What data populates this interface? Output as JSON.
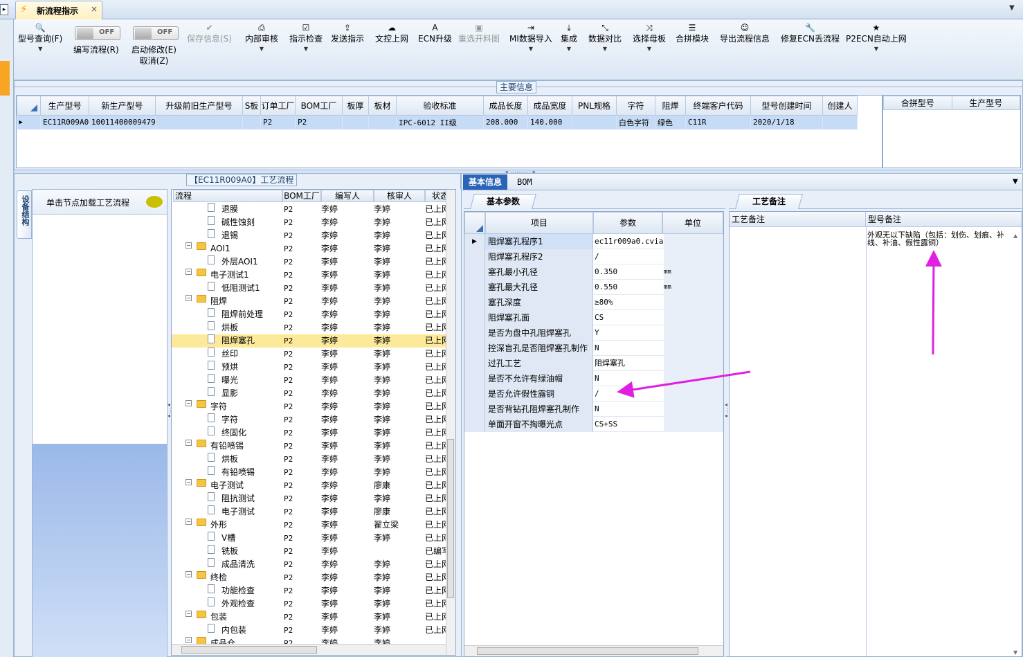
{
  "tab": {
    "title": "新流程指示",
    "close": "×"
  },
  "toolbar": [
    {
      "label": "型号查询(F)",
      "icon": "search-icon",
      "glyph": "🔍",
      "disabled": false,
      "dropdown": true
    },
    {
      "label": "编写流程(R)",
      "toggle": "OFF"
    },
    {
      "label": "启动修改(E)",
      "label2": "取消(Z)",
      "toggle": "OFF"
    },
    {
      "label": "保存信息(S)",
      "icon": "check-icon",
      "glyph": "✔",
      "disabled": true,
      "dropdown": false
    },
    {
      "label": "内部审核",
      "icon": "printer-icon",
      "glyph": "⎙",
      "disabled": false,
      "dropdown": true
    },
    {
      "label": "指示检查",
      "icon": "checkbox-icon",
      "glyph": "☑",
      "disabled": false,
      "dropdown": true
    },
    {
      "label": "发送指示",
      "icon": "upload-icon",
      "glyph": "⇪",
      "disabled": false,
      "dropdown": false
    },
    {
      "label": "文控上网",
      "icon": "cloud-icon",
      "glyph": "☁",
      "disabled": false,
      "dropdown": false
    },
    {
      "label": "ECN升级",
      "icon": "font-icon",
      "glyph": "A",
      "disabled": false,
      "dropdown": false
    },
    {
      "label": "重选开料图",
      "icon": "image-icon",
      "glyph": "▣",
      "disabled": true,
      "dropdown": false
    },
    {
      "label": "MI数据导入",
      "icon": "import-icon",
      "glyph": "⇥",
      "disabled": false,
      "dropdown": true
    },
    {
      "label": "集成",
      "icon": "download-icon",
      "glyph": "⤓",
      "disabled": false,
      "dropdown": true
    },
    {
      "label": "数据对比",
      "icon": "compress-icon",
      "glyph": "⤡",
      "disabled": false,
      "dropdown": true
    },
    {
      "label": "选择母板",
      "icon": "shuffle-icon",
      "glyph": "⤨",
      "disabled": false,
      "dropdown": true
    },
    {
      "label": "合拼模块",
      "icon": "list-icon",
      "glyph": "☰",
      "disabled": false,
      "dropdown": false
    },
    {
      "label": "导出流程信息",
      "icon": "smiley-icon",
      "glyph": "☺",
      "disabled": false,
      "dropdown": false
    },
    {
      "label": "修复ECN丢流程",
      "icon": "wrench-icon",
      "glyph": "🔧",
      "disabled": false,
      "dropdown": false
    },
    {
      "label": "P2ECN自动上网",
      "icon": "star-icon",
      "glyph": "★",
      "disabled": false,
      "dropdown": true
    }
  ],
  "main": {
    "title": "主要信息",
    "columns": [
      "生产型号",
      "新生产型号",
      "升级前旧生产型号",
      "S板",
      "订单工厂",
      "BOM工厂",
      "板厚",
      "板材",
      "验收标准",
      "成品长度",
      "成品宽度",
      "PNL规格",
      "字符",
      "阻焊",
      "终端客户代码",
      "型号创建时间",
      "创建人"
    ],
    "row": [
      "EC11R009A0",
      "10011400009479",
      "",
      "",
      "P2",
      "P2",
      "",
      "",
      "IPC-6012 II级",
      "208.000",
      "140.000",
      "",
      "白色字符",
      "绿色",
      "C11R",
      "2020/1/18",
      ""
    ],
    "merge_columns": [
      "合拼型号",
      "生产型号"
    ]
  },
  "flow": {
    "title": "【EC11R009A0】工艺流程",
    "side_tab": "设备结构",
    "hint": "单击节点加载工艺流程",
    "columns": [
      "流程",
      "BOM工厂",
      "编写人",
      "核审人",
      "状态"
    ],
    "rows": [
      {
        "name": "退膜",
        "level": 2,
        "bom": "P2",
        "writer": "李婷",
        "reviewer": "李婷",
        "status": "已上网"
      },
      {
        "name": "碱性蚀刻",
        "level": 2,
        "bom": "P2",
        "writer": "李婷",
        "reviewer": "李婷",
        "status": "已上网"
      },
      {
        "name": "退锡",
        "level": 2,
        "bom": "P2",
        "writer": "李婷",
        "reviewer": "李婷",
        "status": "已上网"
      },
      {
        "name": "AOI1",
        "level": 1,
        "bom": "P2",
        "writer": "李婷",
        "reviewer": "李婷",
        "status": "已上网"
      },
      {
        "name": "外层AOI1",
        "level": 2,
        "bom": "P2",
        "writer": "李婷",
        "reviewer": "李婷",
        "status": "已上网"
      },
      {
        "name": "电子测试1",
        "level": 1,
        "bom": "P2",
        "writer": "李婷",
        "reviewer": "李婷",
        "status": "已上网"
      },
      {
        "name": "低阻测试1",
        "level": 2,
        "bom": "P2",
        "writer": "李婷",
        "reviewer": "李婷",
        "status": "已上网"
      },
      {
        "name": "阻焊",
        "level": 1,
        "bom": "P2",
        "writer": "李婷",
        "reviewer": "李婷",
        "status": "已上网"
      },
      {
        "name": "阻焊前处理",
        "level": 2,
        "bom": "P2",
        "writer": "李婷",
        "reviewer": "李婷",
        "status": "已上网"
      },
      {
        "name": "烘板",
        "level": 2,
        "bom": "P2",
        "writer": "李婷",
        "reviewer": "李婷",
        "status": "已上网"
      },
      {
        "name": "阻焊塞孔",
        "level": 2,
        "bom": "P2",
        "writer": "李婷",
        "reviewer": "李婷",
        "status": "已上网",
        "selected": true
      },
      {
        "name": "丝印",
        "level": 2,
        "bom": "P2",
        "writer": "李婷",
        "reviewer": "李婷",
        "status": "已上网"
      },
      {
        "name": "预烘",
        "level": 2,
        "bom": "P2",
        "writer": "李婷",
        "reviewer": "李婷",
        "status": "已上网"
      },
      {
        "name": "曝光",
        "level": 2,
        "bom": "P2",
        "writer": "李婷",
        "reviewer": "李婷",
        "status": "已上网"
      },
      {
        "name": "显影",
        "level": 2,
        "bom": "P2",
        "writer": "李婷",
        "reviewer": "李婷",
        "status": "已上网"
      },
      {
        "name": "字符",
        "level": 1,
        "bom": "P2",
        "writer": "李婷",
        "reviewer": "李婷",
        "status": "已上网"
      },
      {
        "name": "字符",
        "level": 2,
        "bom": "P2",
        "writer": "李婷",
        "reviewer": "李婷",
        "status": "已上网"
      },
      {
        "name": "终固化",
        "level": 2,
        "bom": "P2",
        "writer": "李婷",
        "reviewer": "李婷",
        "status": "已上网"
      },
      {
        "name": "有铅喷锡",
        "level": 1,
        "bom": "P2",
        "writer": "李婷",
        "reviewer": "李婷",
        "status": "已上网"
      },
      {
        "name": "烘板",
        "level": 2,
        "bom": "P2",
        "writer": "李婷",
        "reviewer": "李婷",
        "status": "已上网"
      },
      {
        "name": "有铅喷锡",
        "level": 2,
        "bom": "P2",
        "writer": "李婷",
        "reviewer": "李婷",
        "status": "已上网"
      },
      {
        "name": "电子测试",
        "level": 1,
        "bom": "P2",
        "writer": "李婷",
        "reviewer": "廖康",
        "status": "已上网"
      },
      {
        "name": "阻抗测试",
        "level": 2,
        "bom": "P2",
        "writer": "李婷",
        "reviewer": "李婷",
        "status": "已上网"
      },
      {
        "name": "电子测试",
        "level": 2,
        "bom": "P2",
        "writer": "李婷",
        "reviewer": "廖康",
        "status": "已上网"
      },
      {
        "name": "外形",
        "level": 1,
        "bom": "P2",
        "writer": "李婷",
        "reviewer": "翟立梁",
        "status": "已上网"
      },
      {
        "name": "V槽",
        "level": 2,
        "bom": "P2",
        "writer": "李婷",
        "reviewer": "李婷",
        "status": "已上网"
      },
      {
        "name": "铣板",
        "level": 2,
        "bom": "P2",
        "writer": "李婷",
        "reviewer": "",
        "status": "已编写"
      },
      {
        "name": "成品清洗",
        "level": 2,
        "bom": "P2",
        "writer": "李婷",
        "reviewer": "李婷",
        "status": "已上网"
      },
      {
        "name": "终检",
        "level": 1,
        "bom": "P2",
        "writer": "李婷",
        "reviewer": "李婷",
        "status": "已上网"
      },
      {
        "name": "功能检查",
        "level": 2,
        "bom": "P2",
        "writer": "李婷",
        "reviewer": "李婷",
        "status": "已上网"
      },
      {
        "name": "外观检查",
        "level": 2,
        "bom": "P2",
        "writer": "李婷",
        "reviewer": "李婷",
        "status": "已上网"
      },
      {
        "name": "包装",
        "level": 1,
        "bom": "P2",
        "writer": "李婷",
        "reviewer": "李婷",
        "status": "已上网"
      },
      {
        "name": "内包装",
        "level": 2,
        "bom": "P2",
        "writer": "李婷",
        "reviewer": "李婷",
        "status": "已上网"
      },
      {
        "name": "成品仓",
        "level": 1,
        "bom": "P2",
        "writer": "李婷",
        "reviewer": "李婷",
        "status": ""
      }
    ]
  },
  "info": {
    "tabs": [
      "基本信息",
      "BOM"
    ],
    "params_tab": "基本参数",
    "columns": [
      "项目",
      "参数",
      "单位"
    ],
    "rows": [
      {
        "item": "阻焊塞孔程序1",
        "param": "ec11r009a0.cvia",
        "unit": ""
      },
      {
        "item": "阻焊塞孔程序2",
        "param": "/",
        "unit": ""
      },
      {
        "item": "塞孔最小孔径",
        "param": "0.350",
        "unit": "mm"
      },
      {
        "item": "塞孔最大孔径",
        "param": "0.550",
        "unit": "mm"
      },
      {
        "item": "塞孔深度",
        "param": "≥80%",
        "unit": ""
      },
      {
        "item": "阻焊塞孔面",
        "param": "CS",
        "unit": ""
      },
      {
        "item": "是否为盘中孔阻焊塞孔",
        "param": "Y",
        "unit": ""
      },
      {
        "item": "控深盲孔是否阻焊塞孔制作",
        "param": "N",
        "unit": ""
      },
      {
        "item": "过孔工艺",
        "param": "阻焊塞孔",
        "unit": ""
      },
      {
        "item": "是否不允许有绿油帽",
        "param": "N",
        "unit": ""
      },
      {
        "item": "是否允许假性露铜",
        "param": "/",
        "unit": ""
      },
      {
        "item": "是否背钻孔阻焊塞孔制作",
        "param": "N",
        "unit": ""
      },
      {
        "item": "单面开窗不掏曝光点",
        "param": "CS+SS",
        "unit": ""
      }
    ]
  },
  "remarks": {
    "tab": "工艺备注",
    "col1": "工艺备注",
    "col2": "型号备注",
    "note": "外观无以下缺陷（包括：划伤、划痕、补线、补油、假性露铜）"
  },
  "colors": {
    "annotation": "#e020e0",
    "selected_row": "#fde99a",
    "accent": "#1a5fb4"
  }
}
